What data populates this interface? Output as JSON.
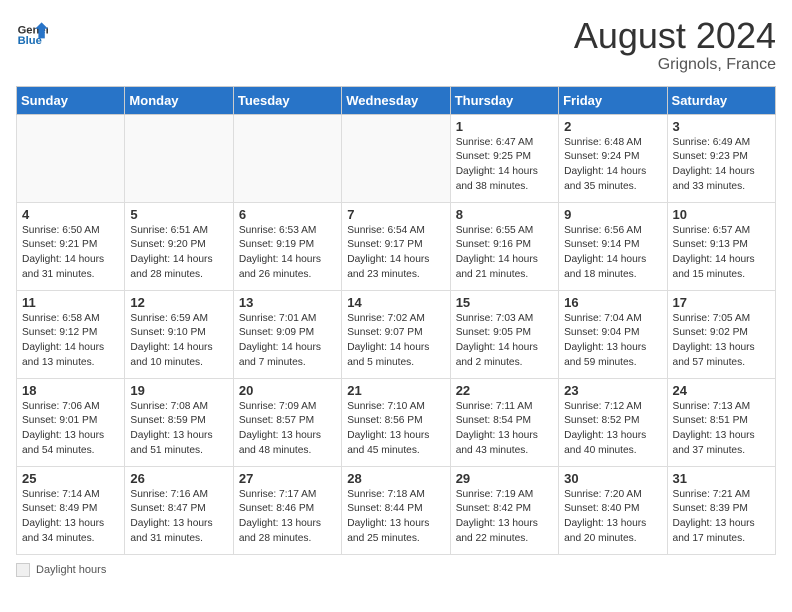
{
  "header": {
    "logo_general": "General",
    "logo_blue": "Blue",
    "month_year": "August 2024",
    "location": "Grignols, France"
  },
  "weekdays": [
    "Sunday",
    "Monday",
    "Tuesday",
    "Wednesday",
    "Thursday",
    "Friday",
    "Saturday"
  ],
  "weeks": [
    [
      {
        "day": "",
        "info": ""
      },
      {
        "day": "",
        "info": ""
      },
      {
        "day": "",
        "info": ""
      },
      {
        "day": "",
        "info": ""
      },
      {
        "day": "1",
        "info": "Sunrise: 6:47 AM\nSunset: 9:25 PM\nDaylight: 14 hours\nand 38 minutes."
      },
      {
        "day": "2",
        "info": "Sunrise: 6:48 AM\nSunset: 9:24 PM\nDaylight: 14 hours\nand 35 minutes."
      },
      {
        "day": "3",
        "info": "Sunrise: 6:49 AM\nSunset: 9:23 PM\nDaylight: 14 hours\nand 33 minutes."
      }
    ],
    [
      {
        "day": "4",
        "info": "Sunrise: 6:50 AM\nSunset: 9:21 PM\nDaylight: 14 hours\nand 31 minutes."
      },
      {
        "day": "5",
        "info": "Sunrise: 6:51 AM\nSunset: 9:20 PM\nDaylight: 14 hours\nand 28 minutes."
      },
      {
        "day": "6",
        "info": "Sunrise: 6:53 AM\nSunset: 9:19 PM\nDaylight: 14 hours\nand 26 minutes."
      },
      {
        "day": "7",
        "info": "Sunrise: 6:54 AM\nSunset: 9:17 PM\nDaylight: 14 hours\nand 23 minutes."
      },
      {
        "day": "8",
        "info": "Sunrise: 6:55 AM\nSunset: 9:16 PM\nDaylight: 14 hours\nand 21 minutes."
      },
      {
        "day": "9",
        "info": "Sunrise: 6:56 AM\nSunset: 9:14 PM\nDaylight: 14 hours\nand 18 minutes."
      },
      {
        "day": "10",
        "info": "Sunrise: 6:57 AM\nSunset: 9:13 PM\nDaylight: 14 hours\nand 15 minutes."
      }
    ],
    [
      {
        "day": "11",
        "info": "Sunrise: 6:58 AM\nSunset: 9:12 PM\nDaylight: 14 hours\nand 13 minutes."
      },
      {
        "day": "12",
        "info": "Sunrise: 6:59 AM\nSunset: 9:10 PM\nDaylight: 14 hours\nand 10 minutes."
      },
      {
        "day": "13",
        "info": "Sunrise: 7:01 AM\nSunset: 9:09 PM\nDaylight: 14 hours\nand 7 minutes."
      },
      {
        "day": "14",
        "info": "Sunrise: 7:02 AM\nSunset: 9:07 PM\nDaylight: 14 hours\nand 5 minutes."
      },
      {
        "day": "15",
        "info": "Sunrise: 7:03 AM\nSunset: 9:05 PM\nDaylight: 14 hours\nand 2 minutes."
      },
      {
        "day": "16",
        "info": "Sunrise: 7:04 AM\nSunset: 9:04 PM\nDaylight: 13 hours\nand 59 minutes."
      },
      {
        "day": "17",
        "info": "Sunrise: 7:05 AM\nSunset: 9:02 PM\nDaylight: 13 hours\nand 57 minutes."
      }
    ],
    [
      {
        "day": "18",
        "info": "Sunrise: 7:06 AM\nSunset: 9:01 PM\nDaylight: 13 hours\nand 54 minutes."
      },
      {
        "day": "19",
        "info": "Sunrise: 7:08 AM\nSunset: 8:59 PM\nDaylight: 13 hours\nand 51 minutes."
      },
      {
        "day": "20",
        "info": "Sunrise: 7:09 AM\nSunset: 8:57 PM\nDaylight: 13 hours\nand 48 minutes."
      },
      {
        "day": "21",
        "info": "Sunrise: 7:10 AM\nSunset: 8:56 PM\nDaylight: 13 hours\nand 45 minutes."
      },
      {
        "day": "22",
        "info": "Sunrise: 7:11 AM\nSunset: 8:54 PM\nDaylight: 13 hours\nand 43 minutes."
      },
      {
        "day": "23",
        "info": "Sunrise: 7:12 AM\nSunset: 8:52 PM\nDaylight: 13 hours\nand 40 minutes."
      },
      {
        "day": "24",
        "info": "Sunrise: 7:13 AM\nSunset: 8:51 PM\nDaylight: 13 hours\nand 37 minutes."
      }
    ],
    [
      {
        "day": "25",
        "info": "Sunrise: 7:14 AM\nSunset: 8:49 PM\nDaylight: 13 hours\nand 34 minutes."
      },
      {
        "day": "26",
        "info": "Sunrise: 7:16 AM\nSunset: 8:47 PM\nDaylight: 13 hours\nand 31 minutes."
      },
      {
        "day": "27",
        "info": "Sunrise: 7:17 AM\nSunset: 8:46 PM\nDaylight: 13 hours\nand 28 minutes."
      },
      {
        "day": "28",
        "info": "Sunrise: 7:18 AM\nSunset: 8:44 PM\nDaylight: 13 hours\nand 25 minutes."
      },
      {
        "day": "29",
        "info": "Sunrise: 7:19 AM\nSunset: 8:42 PM\nDaylight: 13 hours\nand 22 minutes."
      },
      {
        "day": "30",
        "info": "Sunrise: 7:20 AM\nSunset: 8:40 PM\nDaylight: 13 hours\nand 20 minutes."
      },
      {
        "day": "31",
        "info": "Sunrise: 7:21 AM\nSunset: 8:39 PM\nDaylight: 13 hours\nand 17 minutes."
      }
    ]
  ],
  "footer": {
    "label": "Daylight hours"
  }
}
